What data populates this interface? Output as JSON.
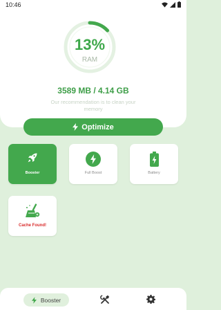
{
  "status_bar": {
    "time": "10:46"
  },
  "ram": {
    "percent": "13%",
    "label": "RAM",
    "ring_fraction": 0.13
  },
  "memory": {
    "usage": "3589 MB / 4.14 GB",
    "recommendation": "Our recommendation is to clean your memory"
  },
  "actions": {
    "optimize_label": "Optimize"
  },
  "tiles": [
    {
      "label": "Booster",
      "icon": "rocket-icon"
    },
    {
      "label": "Full Boost",
      "icon": "lightning-icon"
    },
    {
      "label": "Battery",
      "icon": "battery-icon"
    },
    {
      "label": "Cache Found!",
      "icon": "broom-icon"
    }
  ],
  "bottom_nav": {
    "items": [
      {
        "label": "Booster",
        "icon": "lightning-icon"
      },
      {
        "label": "",
        "icon": "tools-icon"
      },
      {
        "label": "",
        "icon": "gear-icon"
      }
    ]
  },
  "colors": {
    "accent": "#43a84d",
    "ring_track": "#e4f1e2",
    "background": "#dff0dc",
    "alert": "#d92b2b"
  }
}
